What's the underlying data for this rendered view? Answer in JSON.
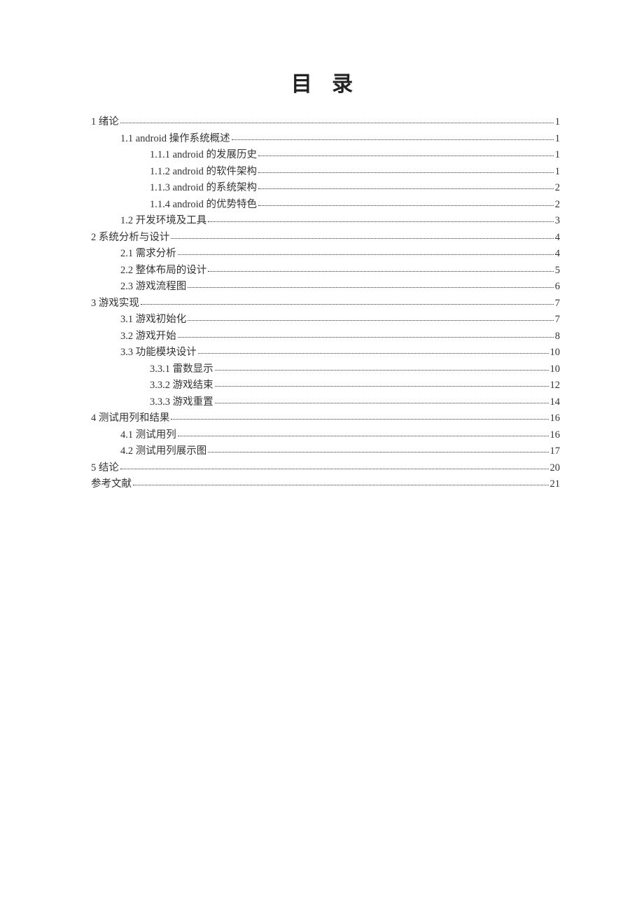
{
  "title": "目 录",
  "toc": [
    {
      "indent": 0,
      "label": "1 绪论",
      "page": "1"
    },
    {
      "indent": 1,
      "label": "1.1 android 操作系统概述",
      "page": "1"
    },
    {
      "indent": 2,
      "label": "1.1.1 android 的发展历史",
      "page": "1"
    },
    {
      "indent": 2,
      "label": "1.1.2 android 的软件架构",
      "page": "1"
    },
    {
      "indent": 2,
      "label": "1.1.3 android 的系统架构",
      "page": "2"
    },
    {
      "indent": 2,
      "label": "1.1.4 android 的优势特色",
      "page": "2"
    },
    {
      "indent": 1,
      "label": "1.2 开发环境及工具",
      "page": "3"
    },
    {
      "indent": 0,
      "label": "2 系统分析与设计",
      "page": "4"
    },
    {
      "indent": 1,
      "label": "2.1 需求分析",
      "page": "4"
    },
    {
      "indent": 1,
      "label": "2.2 整体布局的设计",
      "page": "5"
    },
    {
      "indent": 1,
      "label": "2.3 游戏流程图",
      "page": "6"
    },
    {
      "indent": 0,
      "label": "3 游戏实现",
      "page": "7"
    },
    {
      "indent": 1,
      "label": "3.1 游戏初始化",
      "page": "7"
    },
    {
      "indent": 1,
      "label": "3.2 游戏开始",
      "page": "8"
    },
    {
      "indent": 1,
      "label": "3.3 功能模块设计",
      "page": "10"
    },
    {
      "indent": 2,
      "label": "3.3.1 雷数显示",
      "page": "10"
    },
    {
      "indent": 2,
      "label": "3.3.2 游戏结束",
      "page": "12"
    },
    {
      "indent": 2,
      "label": "3.3.3 游戏重置",
      "page": "14"
    },
    {
      "indent": 0,
      "label": "4 测试用列和结果",
      "page": "16"
    },
    {
      "indent": 1,
      "label": "4.1 测试用列",
      "page": "16"
    },
    {
      "indent": 1,
      "label": "4.2 测试用列展示图",
      "page": "17"
    },
    {
      "indent": 0,
      "label": "5 结论",
      "page": "20"
    },
    {
      "indent": 0,
      "label": "参考文献",
      "page": "21"
    }
  ]
}
